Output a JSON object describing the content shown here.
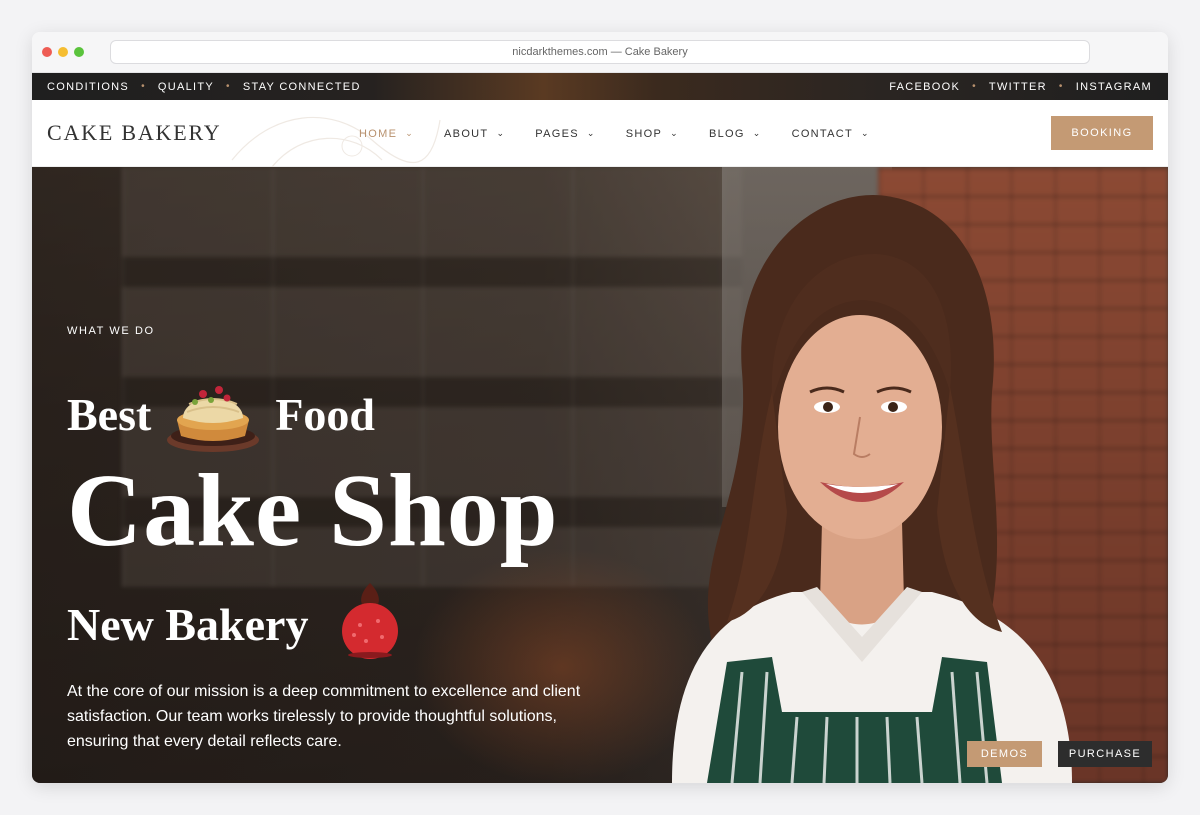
{
  "browser": {
    "url_title": "nicdarkthemes.com — Cake Bakery"
  },
  "topbar": {
    "left_links": [
      "CONDITIONS",
      "QUALITY",
      "STAY CONNECTED"
    ],
    "right_links": [
      "FACEBOOK",
      "TWITTER",
      "INSTAGRAM"
    ],
    "separator": "•"
  },
  "header": {
    "logo": "CAKE BAKERY",
    "menu": [
      {
        "label": "HOME",
        "active": true
      },
      {
        "label": "ABOUT",
        "active": false
      },
      {
        "label": "PAGES",
        "active": false
      },
      {
        "label": "SHOP",
        "active": false
      },
      {
        "label": "BLOG",
        "active": false
      },
      {
        "label": "CONTACT",
        "active": false
      }
    ],
    "chevron": "⌄",
    "booking_label": "BOOKING"
  },
  "hero": {
    "eyebrow": "WHAT WE DO",
    "line1_left": "Best",
    "line1_right": "Food",
    "line2": "Cake Shop",
    "line3": "New Bakery",
    "description": "At the core of our mission is a deep commitment to excellence and client satisfaction. Our team works tirelessly to provide thoughtful solutions, ensuring that every detail reflects care."
  },
  "floating": {
    "demos_label": "DEMOS",
    "purchase_label": "PURCHASE"
  },
  "colors": {
    "accent": "#c49a74",
    "dark": "#2d2d2d",
    "topbar_bg": "#1f1f1f"
  }
}
